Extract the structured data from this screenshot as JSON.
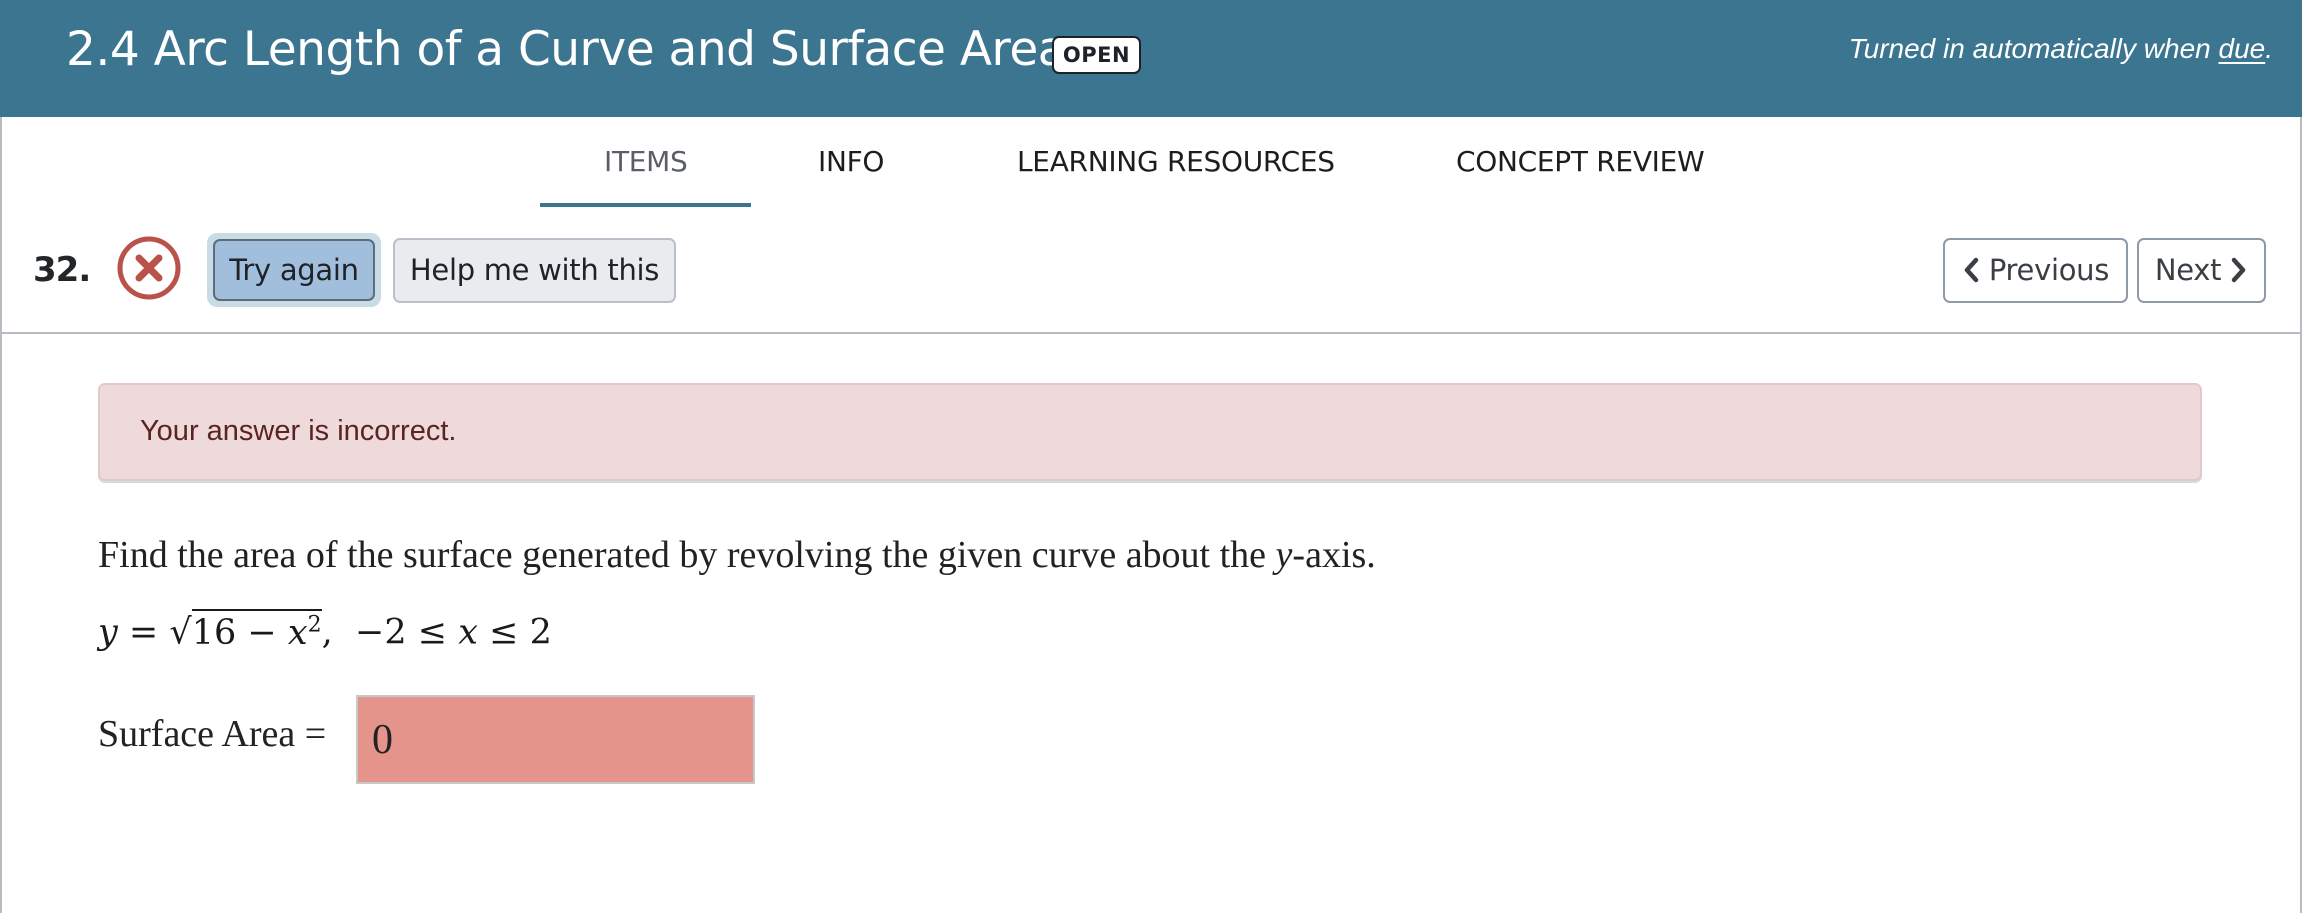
{
  "header": {
    "title": "2.4 Arc Length of a Curve and Surface Area",
    "status_badge": "OPEN",
    "due_prefix": "Turned in automatically when ",
    "due_link": "due",
    "due_suffix": ".",
    "background_color": "#3b758f"
  },
  "tabs": [
    {
      "label": "ITEMS",
      "active": true
    },
    {
      "label": "INFO",
      "active": false
    },
    {
      "label": "LEARNING RESOURCES",
      "active": false
    },
    {
      "label": "CONCEPT REVIEW",
      "active": false
    }
  ],
  "item": {
    "number": "32.",
    "status_icon": "incorrect-x-circle-icon",
    "status_color": "#b8524a",
    "try_again_label": "Try again",
    "help_label": "Help me with this",
    "previous_label": "Previous",
    "next_label": "Next"
  },
  "alert": {
    "message": "Your answer is incorrect.",
    "type": "error"
  },
  "question": {
    "prompt_before": "Find the area of the surface generated by revolving the given curve about the ",
    "prompt_var": "y",
    "prompt_after": "-axis.",
    "equation": {
      "lhs": "y",
      "eq": "=",
      "radicand_const": "16",
      "minus": "−",
      "radicand_var": "x",
      "exponent": "2",
      "comma": ",",
      "lower": "−2",
      "leq1": "≤",
      "var": "x",
      "leq2": "≤",
      "upper": "2"
    },
    "answer_label": "Surface Area =",
    "answer_value": "0",
    "answer_state": "incorrect"
  }
}
